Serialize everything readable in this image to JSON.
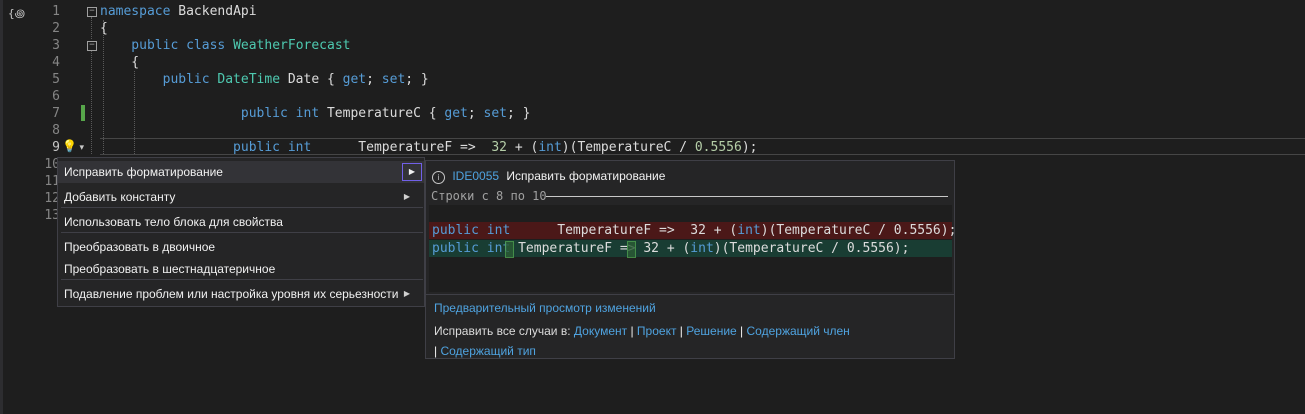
{
  "editor": {
    "doc_icon": "{꩜",
    "line_numbers": [
      "1",
      "2",
      "3",
      "4",
      "5",
      "6",
      "7",
      "8",
      "9",
      "10",
      "11",
      "12",
      "13"
    ],
    "lines": [
      [
        {
          "t": "namespace",
          "c": "kw"
        },
        {
          "t": " BackendApi",
          "c": ""
        }
      ],
      [
        {
          "t": "{",
          "c": ""
        }
      ],
      [
        {
          "t": "    public",
          "c": "kw"
        },
        {
          "t": " ",
          "c": ""
        },
        {
          "t": "class",
          "c": "kw"
        },
        {
          "t": " ",
          "c": ""
        },
        {
          "t": "WeatherForecast",
          "c": "ty"
        }
      ],
      [
        {
          "t": "    {",
          "c": ""
        }
      ],
      [
        {
          "t": "        public",
          "c": "kw"
        },
        {
          "t": " ",
          "c": ""
        },
        {
          "t": "DateTime",
          "c": "ty"
        },
        {
          "t": " Date { ",
          "c": ""
        },
        {
          "t": "get",
          "c": "kw"
        },
        {
          "t": "; ",
          "c": ""
        },
        {
          "t": "set",
          "c": "kw"
        },
        {
          "t": "; }",
          "c": ""
        }
      ],
      [],
      [
        {
          "t": "                  public",
          "c": "kw"
        },
        {
          "t": " ",
          "c": ""
        },
        {
          "t": "int",
          "c": "kw"
        },
        {
          "t": " TemperatureC { ",
          "c": ""
        },
        {
          "t": "get",
          "c": "kw"
        },
        {
          "t": "; ",
          "c": ""
        },
        {
          "t": "set",
          "c": "kw"
        },
        {
          "t": "; }",
          "c": ""
        }
      ],
      [],
      [
        {
          "t": "                 public",
          "c": "kw"
        },
        {
          "t": " ",
          "c": ""
        },
        {
          "t": "int",
          "c": "kw"
        },
        {
          "t": "      TemperatureF =>  ",
          "c": ""
        },
        {
          "t": "32",
          "c": "num"
        },
        {
          "t": " + (",
          "c": ""
        },
        {
          "t": "int",
          "c": "kw"
        },
        {
          "t": ")(TemperatureC / ",
          "c": ""
        },
        {
          "t": "0.5556",
          "c": "num"
        },
        {
          "t": ");",
          "c": ""
        }
      ]
    ]
  },
  "quick_actions": {
    "items": [
      {
        "label": "Исправить форматирование",
        "submenu": true,
        "selected": true
      },
      {
        "label": "Добавить константу",
        "submenu": true
      },
      {
        "label": "Использовать тело блока для свойства",
        "submenu": false
      },
      {
        "label": "Преобразовать в двоичное",
        "submenu": false
      },
      {
        "label": "Преобразовать в шестнадцатеричное",
        "submenu": false
      },
      {
        "label": "Подавление проблем или настройка уровня их серьезности",
        "submenu": true
      }
    ]
  },
  "preview": {
    "icon": "info-icon",
    "diagnostic_id": "IDE0055",
    "title": "Исправить форматирование",
    "range_text": "Строки с 8 по 10",
    "removed_line": [
      {
        "t": "public",
        "c": "kw"
      },
      {
        "t": " ",
        "c": ""
      },
      {
        "t": "int",
        "c": "kw"
      },
      {
        "t": "      TemperatureF =>  32 + (",
        "c": ""
      },
      {
        "t": "int",
        "c": "kw"
      },
      {
        "t": ")(TemperatureC / 0.5556);",
        "c": ""
      }
    ],
    "added_line": [
      {
        "t": "public",
        "c": "kw"
      },
      {
        "t": " ",
        "c": ""
      },
      {
        "t": "int",
        "c": "kw"
      },
      {
        "t": " TemperatureF => 32 + (",
        "c": ""
      },
      {
        "t": "int",
        "c": "kw"
      },
      {
        "t": ")(TemperatureC / 0.5556);",
        "c": ""
      }
    ],
    "preview_changes_link": "Предварительный просмотр изменений",
    "fix_all_label": "Исправить все случаи в:",
    "fix_all_targets": [
      "Документ",
      "Проект",
      "Решение",
      "Содержащий член",
      "Содержащий тип"
    ]
  },
  "colors": {
    "keyword": "#569cd6",
    "type": "#4ec9b0",
    "number": "#b5cea8",
    "removed_bg": "#4b1818",
    "added_bg": "#193d33",
    "link": "#4fa3e0"
  }
}
